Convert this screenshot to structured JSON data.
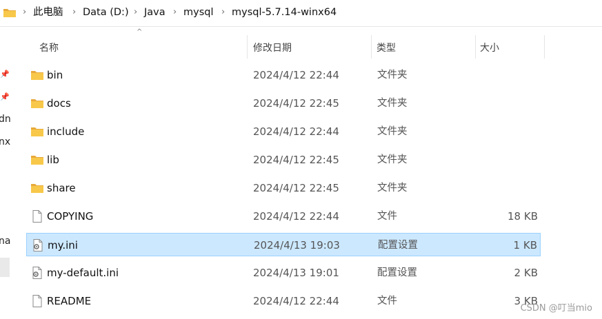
{
  "breadcrumb": {
    "items": [
      "此电脑",
      "Data (D:)",
      "Java",
      "mysql",
      "mysql-5.7.14-winx64"
    ]
  },
  "left_pane": {
    "fragments": [
      "dn",
      "nx",
      "na"
    ]
  },
  "columns": {
    "name": "名称",
    "modified": "修改日期",
    "type": "类型",
    "size": "大小"
  },
  "files": [
    {
      "name": "bin",
      "modified": "2024/4/12 22:44",
      "type": "文件夹",
      "size": "",
      "icon": "folder-icon",
      "selected": false
    },
    {
      "name": "docs",
      "modified": "2024/4/12 22:45",
      "type": "文件夹",
      "size": "",
      "icon": "folder-icon",
      "selected": false
    },
    {
      "name": "include",
      "modified": "2024/4/12 22:44",
      "type": "文件夹",
      "size": "",
      "icon": "folder-icon",
      "selected": false
    },
    {
      "name": "lib",
      "modified": "2024/4/12 22:45",
      "type": "文件夹",
      "size": "",
      "icon": "folder-icon",
      "selected": false
    },
    {
      "name": "share",
      "modified": "2024/4/12 22:45",
      "type": "文件夹",
      "size": "",
      "icon": "folder-icon",
      "selected": false
    },
    {
      "name": "COPYING",
      "modified": "2024/4/12 22:44",
      "type": "文件",
      "size": "18 KB",
      "icon": "file-icon",
      "selected": false
    },
    {
      "name": "my.ini",
      "modified": "2024/4/13 19:03",
      "type": "配置设置",
      "size": "1 KB",
      "icon": "config-file-icon",
      "selected": true
    },
    {
      "name": "my-default.ini",
      "modified": "2024/4/13 19:01",
      "type": "配置设置",
      "size": "2 KB",
      "icon": "config-file-icon",
      "selected": false
    },
    {
      "name": "README",
      "modified": "2024/4/12 22:44",
      "type": "文件",
      "size": "3 KB",
      "icon": "file-icon",
      "selected": false
    }
  ],
  "watermark": "CSDN @叮当mio",
  "colors": {
    "selection_bg": "#cce8ff",
    "selection_border": "#99d1ff",
    "folder": "#f8c84a"
  }
}
